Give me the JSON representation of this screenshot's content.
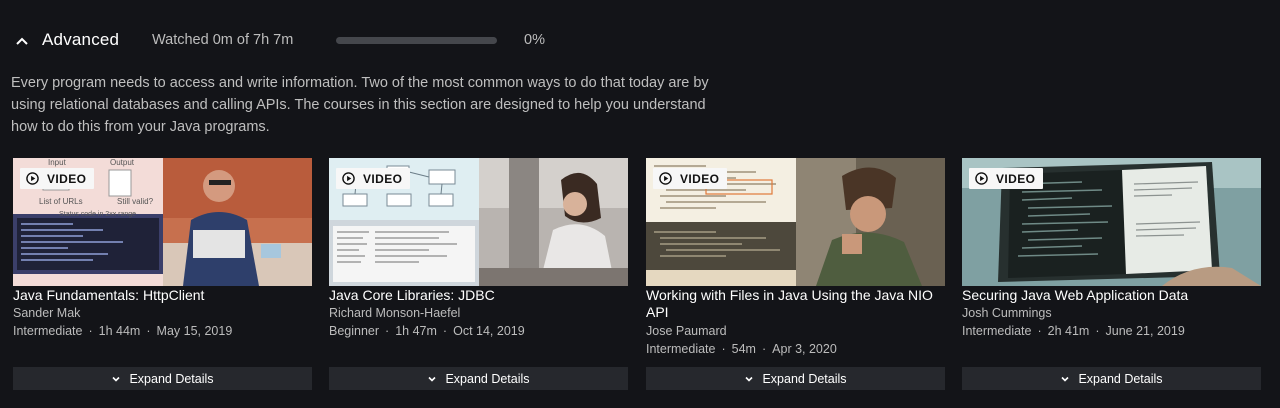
{
  "section": {
    "title": "Advanced",
    "watched": "Watched 0m of 7h 7m",
    "progress_fraction": 0.0,
    "progress_text": "0%",
    "description": "Every program needs to access and write information. Two of the most common ways to do that today are by using relational databases and calling APIs. The courses in this section are designed to help you understand how to do this from your Java programs."
  },
  "colors": {
    "background": "#131418",
    "progress_track": "#45474c",
    "button_bg": "#26282d"
  },
  "icons": {
    "collapse": "chevron-up-icon",
    "badge": "play-circle-icon",
    "expand": "chevron-down-icon"
  },
  "courses": [
    {
      "badge": "VIDEO",
      "title": "Java Fundamentals: HttpClient",
      "author": "Sander Mak",
      "level": "Intermediate",
      "duration": "1h 44m",
      "date": "May 15, 2019",
      "expand_label": "Expand Details",
      "thumbnail_text": {
        "input": "Input",
        "output": "Output",
        "list": "List of URLs",
        "still": "Still valid?",
        "status": "Status code in 2xx range"
      }
    },
    {
      "badge": "VIDEO",
      "title": "Java Core Libraries: JDBC",
      "author": "Richard Monson-Haefel",
      "level": "Beginner",
      "duration": "1h 47m",
      "date": "Oct 14, 2019",
      "expand_label": "Expand Details"
    },
    {
      "badge": "VIDEO",
      "title": "Working with Files in Java Using the Java NIO API",
      "author": "Jose Paumard",
      "level": "Intermediate",
      "duration": "54m",
      "date": "Apr 3, 2020",
      "expand_label": "Expand Details"
    },
    {
      "badge": "VIDEO",
      "title": "Securing Java Web Application Data",
      "author": "Josh Cummings",
      "level": "Intermediate",
      "duration": "2h 41m",
      "date": "June 21, 2019",
      "expand_label": "Expand Details"
    }
  ]
}
